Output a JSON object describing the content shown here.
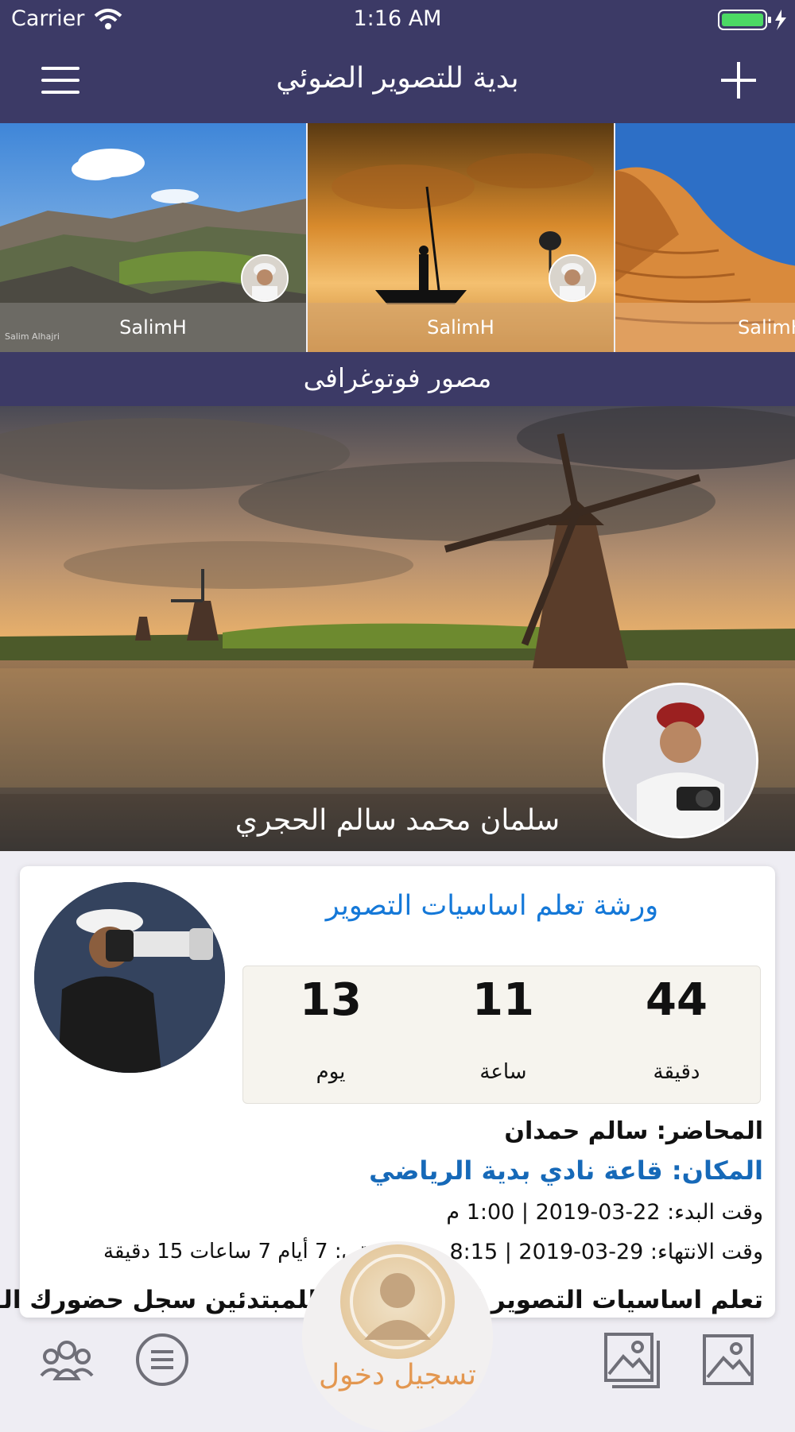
{
  "status_bar": {
    "carrier": "Carrier",
    "time": "1:16 AM"
  },
  "nav": {
    "title": "بدية للتصوير الضوئي",
    "menu_icon": "hamburger-menu-icon",
    "add_icon": "plus-icon"
  },
  "carousel": {
    "items": [
      {
        "author": "SalimH",
        "scene": "mountain-landscape",
        "watermark": "Salim Alhajri"
      },
      {
        "author": "SalimH",
        "scene": "golden-sunset-boat"
      },
      {
        "author": "SalimH",
        "scene": "desert-dunes"
      }
    ]
  },
  "section": {
    "title": "مصور فوتوغرافى"
  },
  "featured": {
    "photographer": "سلمان محمد سالم الحجري",
    "scene": "windmill-sunset"
  },
  "event": {
    "title": "ورشة تعلم اساسيات التصوير",
    "countdown": [
      {
        "value": "44",
        "label": "دقيقة"
      },
      {
        "value": "11",
        "label": "ساعة"
      },
      {
        "value": "13",
        "label": "يوم"
      }
    ],
    "lecturer": "المحاضر: سالم حمدان",
    "place": "المكان: قاعة نادي بدية الرياضي",
    "start": "وقت البدء: 22-03-2019 | 1:00 م",
    "end": "وقت الانتهاء: 29-03-2019 | 8:15",
    "remaining": "متبقي: 7 أيام 7 ساعات 15 دقيقة",
    "description": "تعلم اساسيات التصوير الفوتوغرافي للمبتدئين سجل حضورك الـ..."
  },
  "tabbar": {
    "login_label": "تسجيل دخول",
    "icons": [
      "group-icon",
      "list-icon",
      "gallery-icon",
      "image-icon"
    ]
  },
  "colors": {
    "nav_bg": "#3c3a66",
    "accent_blue": "#1478d8",
    "place_blue": "#1669b8",
    "login_orange": "#e39750"
  }
}
